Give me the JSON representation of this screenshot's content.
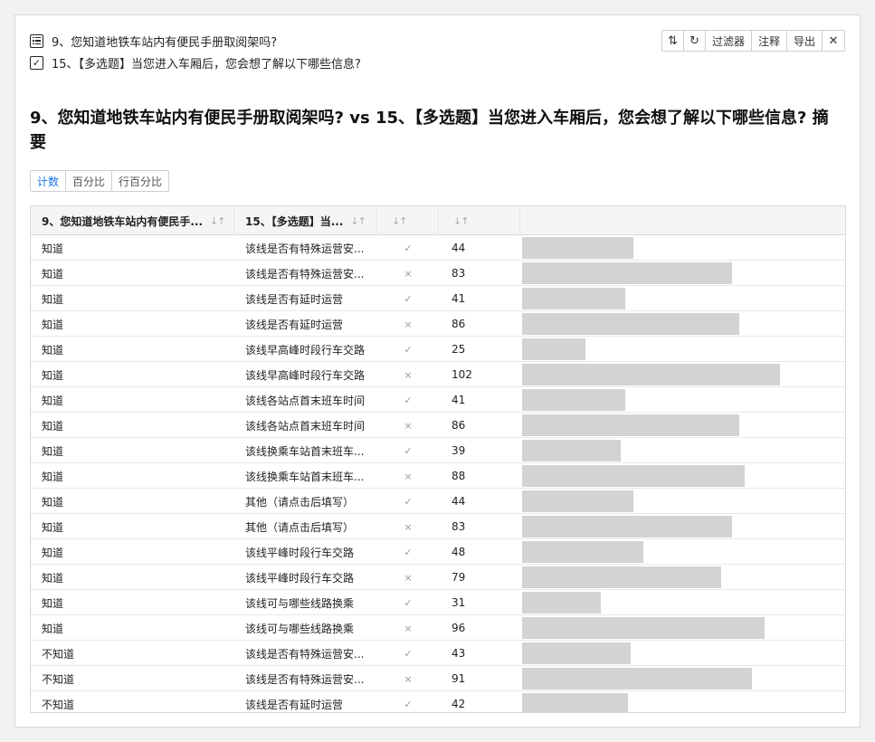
{
  "questions": {
    "q1": "9、您知道地铁车站内有便民手册取阅架吗?",
    "q2": "15、【多选题】当您进入车厢后，您会想了解以下哪些信息?"
  },
  "toolbar": {
    "sort_icon": "sort-icon",
    "refresh_icon": "refresh-icon",
    "filter_label": "过滤器",
    "note_label": "注释",
    "export_label": "导出",
    "close_icon": "close-icon"
  },
  "title": "9、您知道地铁车站内有便民手册取阅架吗?   vs 15、【多选题】当您进入车厢后，您会想了解以下哪些信息?  摘要",
  "view_tabs": [
    "计数",
    "百分比",
    "行百分比"
  ],
  "active_tab": 0,
  "table": {
    "headers": [
      "9、您知道地铁车站内有便民手...",
      "15、【多选题】当...",
      "",
      ""
    ],
    "max_value": 110,
    "rows": [
      {
        "a": "知道",
        "b": "该线是否有特殊运营安...",
        "mark": "✓",
        "count": 44
      },
      {
        "a": "知道",
        "b": "该线是否有特殊运营安...",
        "mark": "×",
        "count": 83
      },
      {
        "a": "知道",
        "b": "该线是否有延时运营",
        "mark": "✓",
        "count": 41
      },
      {
        "a": "知道",
        "b": "该线是否有延时运营",
        "mark": "×",
        "count": 86
      },
      {
        "a": "知道",
        "b": "该线早高峰时段行车交路",
        "mark": "✓",
        "count": 25
      },
      {
        "a": "知道",
        "b": "该线早高峰时段行车交路",
        "mark": "×",
        "count": 102
      },
      {
        "a": "知道",
        "b": "该线各站点首末班车时间",
        "mark": "✓",
        "count": 41
      },
      {
        "a": "知道",
        "b": "该线各站点首末班车时间",
        "mark": "×",
        "count": 86
      },
      {
        "a": "知道",
        "b": "该线换乘车站首末班车...",
        "mark": "✓",
        "count": 39
      },
      {
        "a": "知道",
        "b": "该线换乘车站首末班车...",
        "mark": "×",
        "count": 88
      },
      {
        "a": "知道",
        "b": "其他（请点击后填写）",
        "mark": "✓",
        "count": 44
      },
      {
        "a": "知道",
        "b": "其他（请点击后填写）",
        "mark": "×",
        "count": 83
      },
      {
        "a": "知道",
        "b": "该线平峰时段行车交路",
        "mark": "✓",
        "count": 48
      },
      {
        "a": "知道",
        "b": "该线平峰时段行车交路",
        "mark": "×",
        "count": 79
      },
      {
        "a": "知道",
        "b": "该线可与哪些线路换乘",
        "mark": "✓",
        "count": 31
      },
      {
        "a": "知道",
        "b": "该线可与哪些线路换乘",
        "mark": "×",
        "count": 96
      },
      {
        "a": "不知道",
        "b": "该线是否有特殊运营安...",
        "mark": "✓",
        "count": 43
      },
      {
        "a": "不知道",
        "b": "该线是否有特殊运营安...",
        "mark": "×",
        "count": 91
      },
      {
        "a": "不知道",
        "b": "该线是否有延时运营",
        "mark": "✓",
        "count": 42
      }
    ]
  },
  "colors": {
    "bar": "#d3d3d3",
    "accent": "#1a73e8"
  }
}
